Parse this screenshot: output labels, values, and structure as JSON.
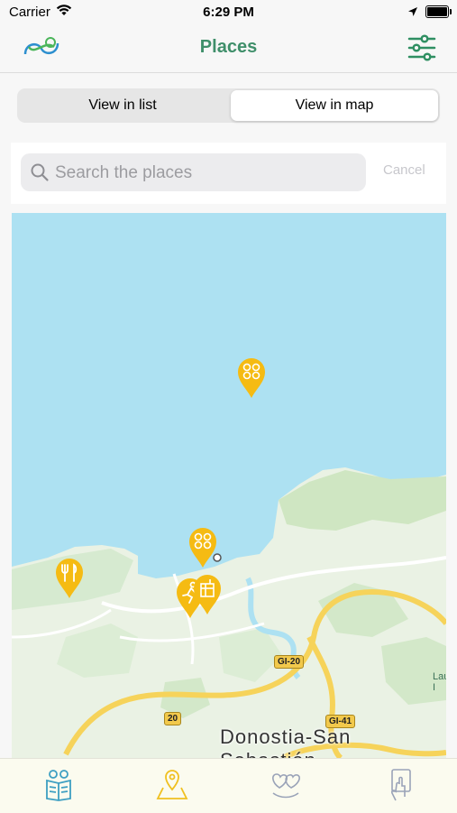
{
  "status_bar": {
    "carrier": "Carrier",
    "time": "6:29 PM"
  },
  "nav": {
    "title": "Places",
    "logo_icon": "app-logo-icon",
    "filter_icon": "sliders-icon",
    "title_color": "#3f8f6a"
  },
  "view_switch": {
    "list_label": "View in list",
    "map_label": "View in map",
    "selected": "View in map"
  },
  "search": {
    "placeholder": "Search the places",
    "value": "",
    "cancel_label": "Cancel"
  },
  "map": {
    "city_label_line1": "Donostia-San",
    "city_label_line2": "Sebastián",
    "road_labels": [
      "GI-20",
      "20",
      "GI-41"
    ],
    "edge_label_line1": "Lau",
    "edge_label_line2": "I",
    "pins": [
      {
        "icon": "people-group-icon",
        "category": "group"
      },
      {
        "icon": "people-group-icon",
        "category": "group"
      },
      {
        "icon": "fork-knife-icon",
        "category": "restaurant"
      },
      {
        "icon": "runner-icon",
        "category": "sport"
      },
      {
        "icon": "building-icon",
        "category": "building"
      }
    ],
    "pin_color": "#f5bb13"
  },
  "tab_bar": {
    "tabs": [
      {
        "icon": "reading-book-icon",
        "active": false
      },
      {
        "icon": "map-pin-icon",
        "active": true
      },
      {
        "icon": "hearts-icon",
        "active": false
      },
      {
        "icon": "hand-touch-icon",
        "active": false
      }
    ],
    "active_color": "#f0c020"
  }
}
